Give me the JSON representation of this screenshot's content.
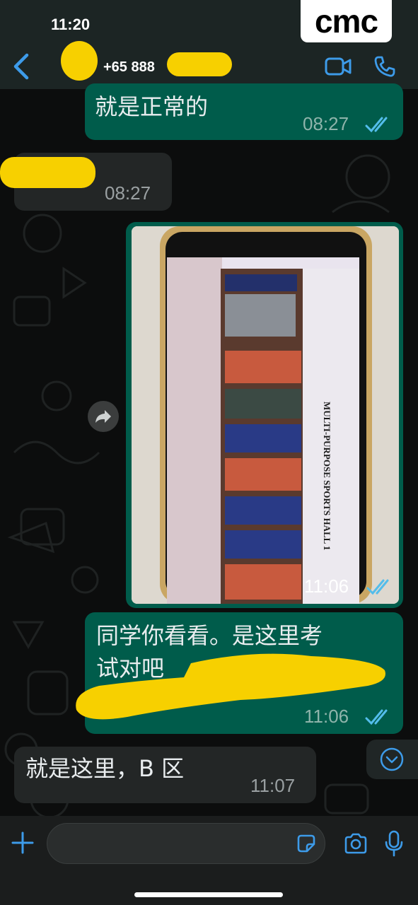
{
  "status_bar": {
    "time": "11:20"
  },
  "watermark": {
    "text": "cmc"
  },
  "header": {
    "contact_name": "+65 888",
    "icons": [
      "back-icon",
      "video-call-icon",
      "phone-icon"
    ]
  },
  "messages": [
    {
      "direction": "out",
      "text": "就是正常的",
      "time": "08:27",
      "status": "read"
    },
    {
      "direction": "in",
      "text": "",
      "time": "08:27"
    },
    {
      "direction": "out",
      "type": "image",
      "image_sign": "MULTI-PURPOSE SPORTS HALL 1",
      "time": "11:06",
      "status": "read"
    },
    {
      "direction": "out",
      "text_line1": "同学你看看。是这里考",
      "text_line2": "试对吧",
      "time": "11:06",
      "status": "read"
    },
    {
      "direction": "in",
      "text": "就是这里，B 区",
      "time": "11:07"
    }
  ],
  "input_bar": {
    "placeholder": "",
    "icons": [
      "plus-icon",
      "sticker-icon",
      "camera-icon",
      "mic-icon"
    ]
  },
  "colors": {
    "outgoing_bubble": "#005c4b",
    "incoming_bubble": "#232626",
    "read_ticks": "#53bdeb",
    "redaction": "#f7d000"
  }
}
